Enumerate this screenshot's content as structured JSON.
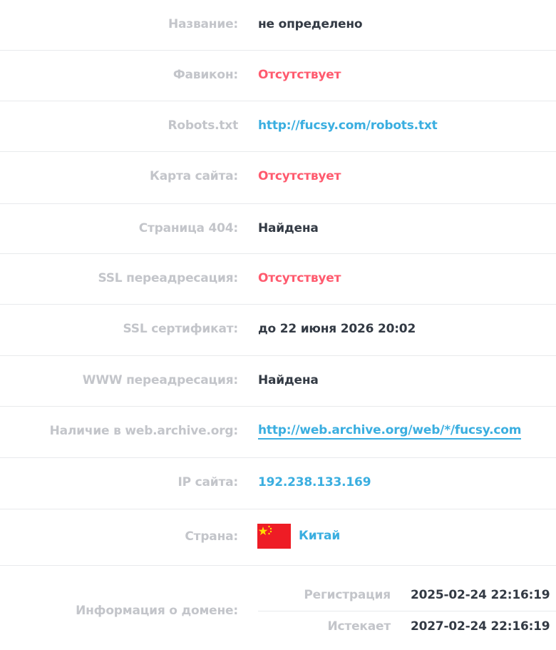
{
  "rows": [
    {
      "label": "Название:",
      "value": "не определено"
    },
    {
      "label": "Фавикон:",
      "value": "Отсутствует"
    },
    {
      "label": "Robots.txt",
      "value": "http://fucsy.com/robots.txt"
    },
    {
      "label": "Карта сайта:",
      "value": "Отсутствует"
    },
    {
      "label": "Страница 404:",
      "value": "Найдена"
    },
    {
      "label": "SSL переадресация:",
      "value": "Отсутствует"
    },
    {
      "label": "SSL сертификат:",
      "value": "до 22 июня 2026 20:02"
    },
    {
      "label": "WWW переадресация:",
      "value": "Найдена"
    },
    {
      "label": "Наличие в web.archive.org:",
      "value": "http://web.archive.org/web/*/fucsy.com"
    },
    {
      "label": "IP сайта:",
      "value": "192.238.133.169"
    },
    {
      "label": "Страна:",
      "value": "Китай",
      "flag": "china-flag-icon"
    },
    {
      "label": "Информация о домене:",
      "sub": [
        {
          "label": "Регистрация",
          "value": "2025-02-24 22:16:19"
        },
        {
          "label": "Истекает",
          "value": "2027-02-24 22:16:19"
        }
      ]
    }
  ],
  "colors": {
    "label": "#c3c5ca",
    "value": "#333a44",
    "missing": "#ff5a6e",
    "link": "#3aaee0",
    "divider": "#e8eaec",
    "flag_red": "#ee1c25",
    "flag_star": "#ffde00"
  }
}
